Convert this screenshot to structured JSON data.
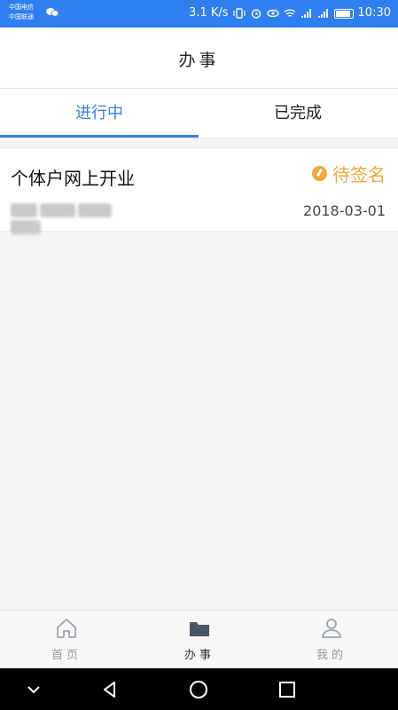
{
  "statusbar": {
    "carrier1": "中国电信",
    "carrier2": "中国联通",
    "speed": "3.1 K/s",
    "time": "10:30",
    "icons": [
      "wechat-icon",
      "vibrate-icon",
      "alarm-icon",
      "eye-icon",
      "wifi-icon",
      "signal-icon",
      "signal-icon",
      "battery-icon"
    ]
  },
  "header": {
    "title": "办事"
  },
  "tabs": [
    {
      "label": "进行中",
      "active": true
    },
    {
      "label": "已完成",
      "active": false
    }
  ],
  "items": [
    {
      "title": "个体户网上开业",
      "status": "待签名",
      "date": "2018-03-01",
      "status_icon": "pending-icon"
    }
  ],
  "bottom_nav": [
    {
      "label": "首页",
      "icon": "home-icon",
      "active": false
    },
    {
      "label": "办事",
      "icon": "folder-icon",
      "active": true
    },
    {
      "label": "我的",
      "icon": "user-icon",
      "active": false
    }
  ],
  "colors": {
    "accent": "#2f7ff0",
    "warning": "#f2a73a",
    "statusbar": "#2f7ff0"
  }
}
